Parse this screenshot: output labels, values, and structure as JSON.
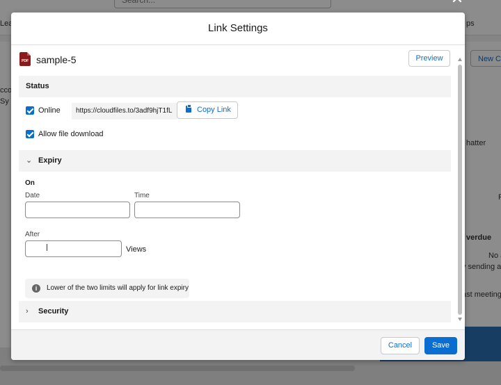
{
  "background": {
    "search_placeholder": "Search...",
    "left_nav_fragment": "Lead",
    "right_nav_fragment": "ps",
    "new_button_fragment": "New C",
    "account_fragment": "ccou",
    "sy_fragment": "Sy",
    "chatter_fragment": "hatter",
    "f_fragment": "F",
    "overdue_fragment": "verdue",
    "no_fragment": "No a",
    "sending_fragment": "y sending a",
    "meeting_fragment": "ast meeting"
  },
  "modal": {
    "title": "Link Settings",
    "file": {
      "name": "sample-5",
      "icon": "pdf-file-icon",
      "icon_text": "PDF"
    },
    "preview_label": "Preview",
    "status": {
      "heading": "Status",
      "online_label": "Online",
      "online_checked": true,
      "url": "https://cloudfiles.to/3adf9hjT1fL",
      "copy_label": "Copy Link",
      "allow_download_label": "Allow file download",
      "allow_download_checked": true
    },
    "expiry": {
      "heading": "Expiry",
      "expanded": true,
      "on_label": "On",
      "date_label": "Date",
      "date_value": "",
      "time_label": "Time",
      "time_value": "",
      "after_label": "After",
      "views_value": "",
      "views_label": "Views",
      "info_text": "Lower of the two limits will apply for link expiry"
    },
    "security": {
      "heading": "Security",
      "expanded": false
    },
    "cancel_label": "Cancel",
    "save_label": "Save",
    "colors": {
      "accent": "#0a6ed1",
      "pdf": "#8b1a1a",
      "section_bg": "#f3f3f3"
    }
  }
}
